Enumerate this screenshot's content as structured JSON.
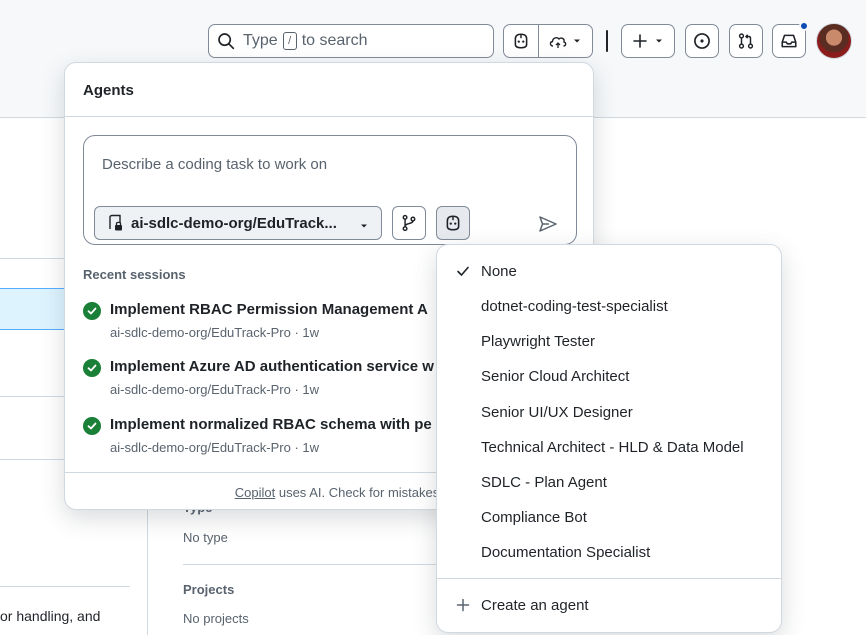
{
  "header": {
    "search_prefix": "Type",
    "search_key": "/",
    "search_suffix": "to search"
  },
  "background": {
    "type_label": "Type",
    "type_value": "No type",
    "projects_label": "Projects",
    "projects_value": "No projects",
    "body_fragment": "or handling, and"
  },
  "agents_panel": {
    "title": "Agents",
    "task_placeholder": "Describe a coding task to work on",
    "repo": "ai-sdlc-demo-org/EduTrack...",
    "recent_heading": "Recent sessions",
    "sessions": [
      {
        "title": "Implement RBAC Permission Management A",
        "meta": "ai-sdlc-demo-org/EduTrack-Pro · 1w",
        "status": "completed"
      },
      {
        "title": "Implement Azure AD authentication service w",
        "meta": "ai-sdlc-demo-org/EduTrack-Pro · 1w",
        "status": "completed"
      },
      {
        "title": "Implement normalized RBAC schema with pe",
        "meta": "ai-sdlc-demo-org/EduTrack-Pro · 1w",
        "status": "completed"
      }
    ],
    "footer_link": "Copilot",
    "footer_text": "uses AI. Check for mistakes"
  },
  "agent_menu": {
    "selected": "None",
    "items": [
      "None",
      "dotnet-coding-test-specialist",
      "Playwright Tester",
      "Senior Cloud Architect",
      "Senior UI/UX Designer",
      "Technical Architect - HLD & Data Model",
      "SDLC - Plan Agent",
      "Compliance Bot",
      "Documentation Specialist"
    ],
    "create_label": "Create an agent"
  },
  "colors": {
    "success": "#1a7f37",
    "notification": "#0e4bb5",
    "selection_bg": "#ddf4ff"
  }
}
